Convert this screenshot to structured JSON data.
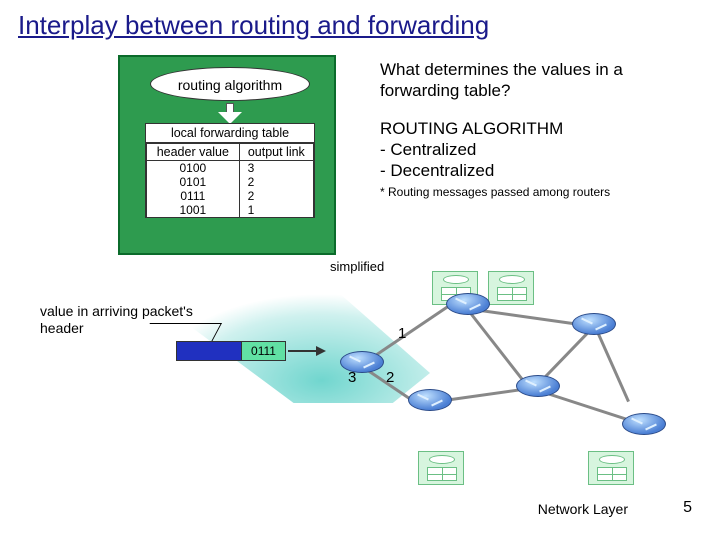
{
  "title": "Interplay between routing and forwarding",
  "router_box": {
    "algorithm_label": "routing algorithm",
    "table_caption": "local forwarding table",
    "columns": [
      "header value",
      "output link"
    ],
    "rows": [
      {
        "hv": "0100",
        "ol": "3"
      },
      {
        "hv": "0101",
        "ol": "2"
      },
      {
        "hv": "0111",
        "ol": "2"
      },
      {
        "hv": "1001",
        "ol": "1"
      }
    ]
  },
  "right": {
    "question": "What determines the values in a forwarding table?",
    "heading": "ROUTING ALGORITHM",
    "bullet1": "- Centralized",
    "bullet2": "- Decentralized",
    "note": "* Routing messages passed among routers"
  },
  "simplified_label": "simplified",
  "arriving_label": "value in arriving packet's header",
  "packet_header_value": "0111",
  "ports": {
    "one": "1",
    "two": "2",
    "three": "3"
  },
  "footer": {
    "layer": "Network Layer",
    "page": "5"
  }
}
